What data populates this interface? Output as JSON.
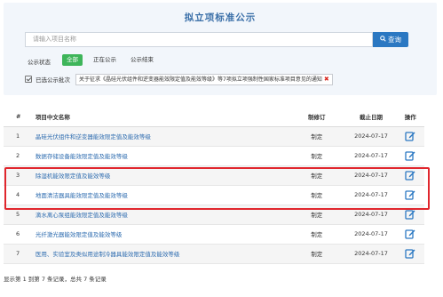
{
  "page": {
    "title": "拟立项标准公示"
  },
  "search": {
    "placeholder": "请输入项目名称",
    "button_label": "查询"
  },
  "filters": {
    "status_label": "公示状态",
    "options": [
      {
        "label": "全部",
        "active": true
      },
      {
        "label": "正在公示",
        "active": false
      },
      {
        "label": "公示结束",
        "active": false
      }
    ]
  },
  "batch": {
    "label": "已选公示批次",
    "selected": "关于征求《晶硅光伏组件和逆变器能效限定值及能效等级》等7项拟立项强制性国家标准项目意见的通知"
  },
  "table": {
    "headers": {
      "index": "#",
      "name": "项目中文名称",
      "revision": "制修订",
      "deadline": "截止日期",
      "action": "操作"
    },
    "rows": [
      {
        "index": "1",
        "name": "晶硅光伏组件和逆变器能效限定值及能效等级",
        "revision": "制定",
        "deadline": "2024-07-17"
      },
      {
        "index": "2",
        "name": "数据存储设备能效限定值及能效等级",
        "revision": "制定",
        "deadline": "2024-07-17"
      },
      {
        "index": "3",
        "name": "除湿机能效限定值及能效等级",
        "revision": "制定",
        "deadline": "2024-07-17"
      },
      {
        "index": "4",
        "name": "地面清洁器具能效限定值及能效等级",
        "revision": "制定",
        "deadline": "2024-07-17"
      },
      {
        "index": "5",
        "name": "滴水离心泵组能效限定值及能效等级",
        "revision": "制定",
        "deadline": "2024-07-17"
      },
      {
        "index": "6",
        "name": "光纤激光器能效限定值及能效等级",
        "revision": "制定",
        "deadline": "2024-07-17"
      },
      {
        "index": "7",
        "name": "医用、实验室及类似用途制冷器具能效限定值及能效等级",
        "revision": "制定",
        "deadline": "2024-07-17"
      }
    ]
  },
  "pagination": {
    "summary": "显示第 1 到第 7 条记录，总共 7 条记录"
  },
  "colors": {
    "accent": "#2b78c2",
    "active_chip": "#3eb55a",
    "highlight": "#e0262d",
    "link": "#2f6db0"
  },
  "icons": {
    "search": "search-icon",
    "edit": "edit-icon",
    "check": "check-icon",
    "remove": "close-icon"
  }
}
